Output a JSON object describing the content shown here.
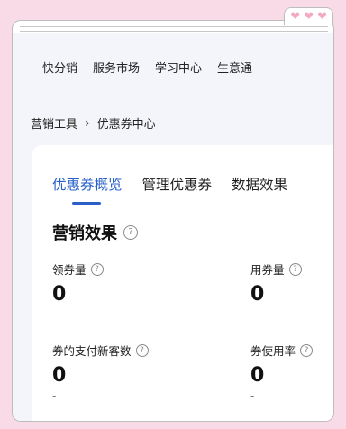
{
  "top_nav": [
    "快分销",
    "服务市场",
    "学习中心",
    "生意通"
  ],
  "breadcrumb": {
    "parent": "营销工具",
    "separator": "›",
    "current": "优惠券中心"
  },
  "tabs": [
    "优惠券概览",
    "管理优惠券",
    "数据效果"
  ],
  "section": {
    "title": "营销效果"
  },
  "metrics": [
    {
      "label": "领券量",
      "value": "0",
      "sub": "-"
    },
    {
      "label": "用券量",
      "value": "0",
      "sub": "-"
    },
    {
      "label": "券的支付新客数",
      "value": "0",
      "sub": "-"
    },
    {
      "label": "券使用率",
      "value": "0",
      "sub": "-"
    }
  ],
  "colors": {
    "accent": "#2a61c9",
    "frame_background": "#f9dbe7",
    "page_background": "#f3f5fb"
  },
  "icons": {
    "help": "question-circle-icon",
    "decor": "heart-icon"
  }
}
